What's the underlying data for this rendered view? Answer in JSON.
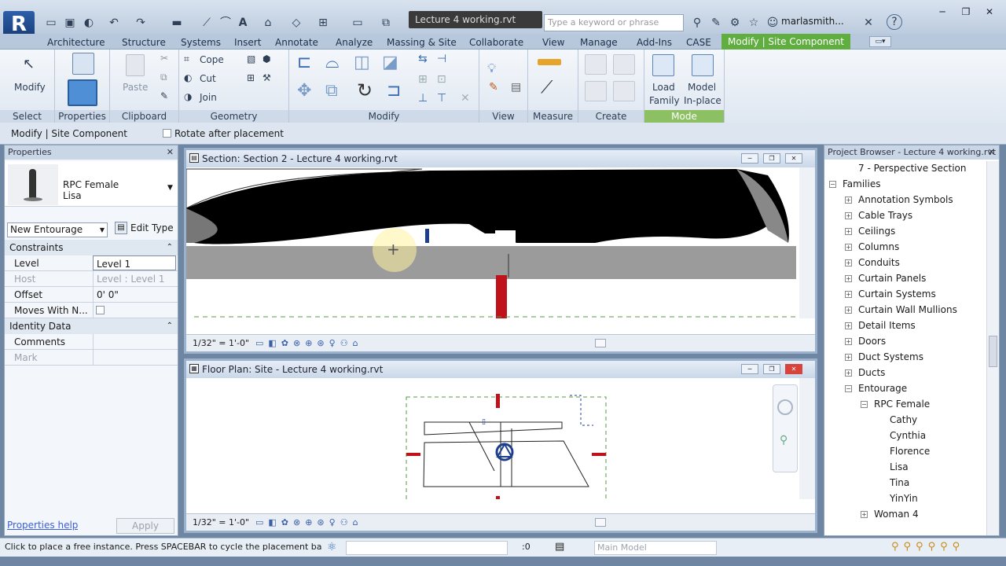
{
  "app": {
    "logo": "R",
    "doc_title": "Lecture 4 working.rvt",
    "search_placeholder": "Type a keyword or phrase",
    "user": "marlasmith...",
    "help": "?"
  },
  "tabs": [
    {
      "label": "Architecture"
    },
    {
      "label": "Structure"
    },
    {
      "label": "Systems"
    },
    {
      "label": "Insert"
    },
    {
      "label": "Annotate"
    },
    {
      "label": "Analyze"
    },
    {
      "label": "Massing & Site"
    },
    {
      "label": "Collaborate"
    },
    {
      "label": "View"
    },
    {
      "label": "Manage"
    },
    {
      "label": "Add-Ins"
    },
    {
      "label": "CASE"
    },
    {
      "label": "Modify | Site Component",
      "active": true
    }
  ],
  "ribbon": {
    "select": {
      "modify": "Modify",
      "label": "Select"
    },
    "properties": {
      "label": "Properties"
    },
    "clipboard": {
      "paste": "Paste",
      "label": "Clipboard"
    },
    "geometry": {
      "cope": "Cope",
      "cut": "Cut",
      "join": "Join",
      "label": "Geometry"
    },
    "modify": {
      "label": "Modify"
    },
    "view": {
      "label": "View"
    },
    "measure": {
      "label": "Measure"
    },
    "create": {
      "label": "Create"
    },
    "mode": {
      "load_family_1": "Load",
      "load_family_2": "Family",
      "model_inplace_1": "Model",
      "model_inplace_2": "In-place",
      "label": "Mode"
    }
  },
  "options_bar": {
    "context": "Modify | Site Component",
    "rotate_after_placement": "Rotate after placement"
  },
  "properties": {
    "header": "Properties",
    "type_name_1": "RPC Female",
    "type_name_2": "Lisa",
    "instance_filter": "New Entourage",
    "edit_type": "Edit Type",
    "groups": {
      "constraints": "Constraints",
      "identity": "Identity Data"
    },
    "rows": {
      "level_k": "Level",
      "level_v": "Level 1",
      "host_k": "Host",
      "host_v": "Level : Level 1",
      "offset_k": "Offset",
      "offset_v": "0' 0\"",
      "moves_k": "Moves With N...",
      "comments_k": "Comments",
      "mark_k": "Mark"
    },
    "help_link": "Properties help",
    "apply": "Apply"
  },
  "views": {
    "section_title": "Section: Section 2 - Lecture 4 working.rvt",
    "plan_title": "Floor Plan: Site - Lecture 4 working.rvt",
    "scale": "1/32\" = 1'-0\""
  },
  "project_browser": {
    "header": "Project Browser - Lecture 4 working.rvt",
    "items": [
      {
        "label": "7 - Perspective Section",
        "indent": 1,
        "expander": ""
      },
      {
        "label": "Families",
        "indent": 0,
        "expander": "−"
      },
      {
        "label": "Annotation Symbols",
        "indent": 1,
        "expander": "+"
      },
      {
        "label": "Cable Trays",
        "indent": 1,
        "expander": "+"
      },
      {
        "label": "Ceilings",
        "indent": 1,
        "expander": "+"
      },
      {
        "label": "Columns",
        "indent": 1,
        "expander": "+"
      },
      {
        "label": "Conduits",
        "indent": 1,
        "expander": "+"
      },
      {
        "label": "Curtain Panels",
        "indent": 1,
        "expander": "+"
      },
      {
        "label": "Curtain Systems",
        "indent": 1,
        "expander": "+"
      },
      {
        "label": "Curtain Wall Mullions",
        "indent": 1,
        "expander": "+"
      },
      {
        "label": "Detail Items",
        "indent": 1,
        "expander": "+"
      },
      {
        "label": "Doors",
        "indent": 1,
        "expander": "+"
      },
      {
        "label": "Duct Systems",
        "indent": 1,
        "expander": "+"
      },
      {
        "label": "Ducts",
        "indent": 1,
        "expander": "+"
      },
      {
        "label": "Entourage",
        "indent": 1,
        "expander": "−"
      },
      {
        "label": "RPC Female",
        "indent": 2,
        "expander": "−"
      },
      {
        "label": "Cathy",
        "indent": 3,
        "expander": ""
      },
      {
        "label": "Cynthia",
        "indent": 3,
        "expander": ""
      },
      {
        "label": "Florence",
        "indent": 3,
        "expander": ""
      },
      {
        "label": "Lisa",
        "indent": 3,
        "expander": ""
      },
      {
        "label": "Tina",
        "indent": 3,
        "expander": ""
      },
      {
        "label": "YinYin",
        "indent": 3,
        "expander": ""
      },
      {
        "label": "Woman 4",
        "indent": 2,
        "expander": "+"
      }
    ]
  },
  "status": {
    "message": "Click to place a free instance. Press SPACEBAR to cycle the placement basep",
    "zero": ":0",
    "model": "Main Model"
  }
}
